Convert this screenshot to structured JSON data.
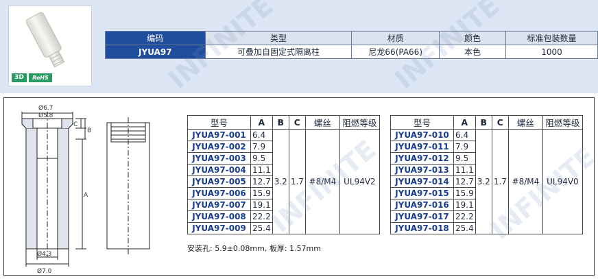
{
  "badges": {
    "three_d": "3D",
    "rohs": "RoHS"
  },
  "info_table": {
    "headers": [
      "编码",
      "类型",
      "材质",
      "颜色",
      "标准包装数量"
    ],
    "row": [
      "JYUA97",
      "可叠加自固定式隔离柱",
      "尼龙66(PA66)",
      "本色",
      "1000"
    ]
  },
  "drawing": {
    "dim_top_outer": "Ø6.7",
    "dim_top_inner": "Ø5.8",
    "dim_c": "C",
    "dim_b": "B",
    "dim_a": "A",
    "dim_bottom_inner": "Ø4.3",
    "dim_bottom_outer": "Ø7.0"
  },
  "spec_headers": [
    "型号",
    "A",
    "B",
    "C",
    "螺丝",
    "阻燃等级"
  ],
  "spec_left": {
    "rows": [
      {
        "model": "JYUA97-001",
        "a": "6.4"
      },
      {
        "model": "JYUA97-002",
        "a": "7.9"
      },
      {
        "model": "JYUA97-003",
        "a": "9.5"
      },
      {
        "model": "JYUA97-004",
        "a": "11.1"
      },
      {
        "model": "JYUA97-005",
        "a": "12.7"
      },
      {
        "model": "JYUA97-006",
        "a": "15.9"
      },
      {
        "model": "JYUA97-007",
        "a": "19.1"
      },
      {
        "model": "JYUA97-008",
        "a": "22.2"
      },
      {
        "model": "JYUA97-009",
        "a": "25.4"
      }
    ],
    "b": "3.2",
    "c": "1.7",
    "screw": "#8/M4",
    "flame": "UL94V2"
  },
  "spec_right": {
    "rows": [
      {
        "model": "JYUA97-010",
        "a": "6.4"
      },
      {
        "model": "JYUA97-011",
        "a": "7.9"
      },
      {
        "model": "JYUA97-012",
        "a": "9.5"
      },
      {
        "model": "JYUA97-013",
        "a": "11.1"
      },
      {
        "model": "JYUA97-014",
        "a": "12.7"
      },
      {
        "model": "JYUA97-015",
        "a": "15.9"
      },
      {
        "model": "JYUA97-016",
        "a": "19.1"
      },
      {
        "model": "JYUA97-017",
        "a": "22.2"
      },
      {
        "model": "JYUA97-018",
        "a": "25.4"
      }
    ],
    "b": "3.2",
    "c": "1.7",
    "screw": "#8/M4",
    "flame": "UL94V0"
  },
  "note": "安装孔: 5.9±0.08mm, 板厚: 1.57mm",
  "colors": {
    "band": "#dce6f4",
    "code_blue": "#1f4d9d",
    "model_blue": "#1a3e8f",
    "badge_green": "#2a9a64"
  }
}
